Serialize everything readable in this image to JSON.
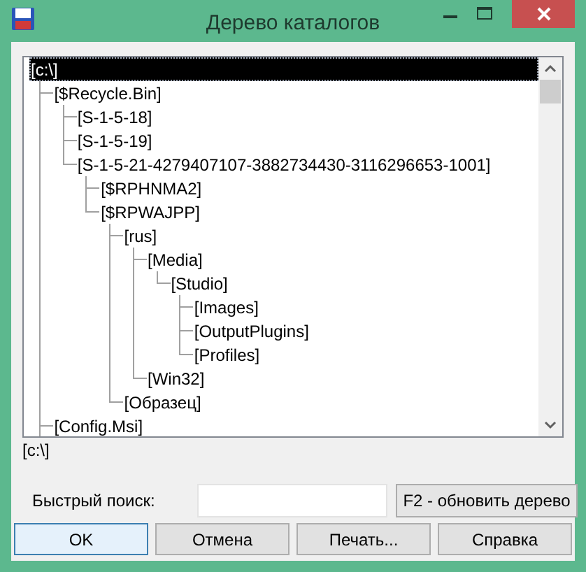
{
  "window": {
    "title": "Дерево каталогов"
  },
  "tree": {
    "nodes": [
      {
        "label": "[c:\\]",
        "selected": true,
        "children": [
          {
            "label": "[$Recycle.Bin]",
            "selected": false,
            "children": [
              {
                "label": "[S-1-5-18]",
                "selected": false
              },
              {
                "label": "[S-1-5-19]",
                "selected": false
              },
              {
                "label": "[S-1-5-21-4279407107-3882734430-3116296653-1001]",
                "selected": false,
                "children": [
                  {
                    "label": "[$RPHNMA2]",
                    "selected": false
                  },
                  {
                    "label": "[$RPWAJPP]",
                    "selected": false,
                    "children": [
                      {
                        "label": "[rus]",
                        "selected": false,
                        "children": [
                          {
                            "label": "[Media]",
                            "selected": false,
                            "children": [
                              {
                                "label": "[Studio]",
                                "selected": false,
                                "children": [
                                  {
                                    "label": "[Images]",
                                    "selected": false
                                  },
                                  {
                                    "label": "[OutputPlugins]",
                                    "selected": false
                                  },
                                  {
                                    "label": "[Profiles]",
                                    "selected": false
                                  }
                                ]
                              }
                            ]
                          },
                          {
                            "label": "[Win32]",
                            "selected": false
                          }
                        ]
                      },
                      {
                        "label": "[Образец]",
                        "selected": false
                      }
                    ]
                  }
                ]
              }
            ]
          },
          {
            "label": "[Config.Msi]",
            "selected": false
          }
        ]
      }
    ]
  },
  "current_path": "[c:\\]",
  "quick_search": {
    "label": "Быстрый поиск:"
  },
  "refresh_button": "F2 - обновить дерево",
  "buttons": [
    {
      "label": "OK",
      "focused": true
    },
    {
      "label": "Отмена",
      "focused": false
    },
    {
      "label": "Печать...",
      "focused": false
    },
    {
      "label": "Справка",
      "focused": false
    }
  ]
}
